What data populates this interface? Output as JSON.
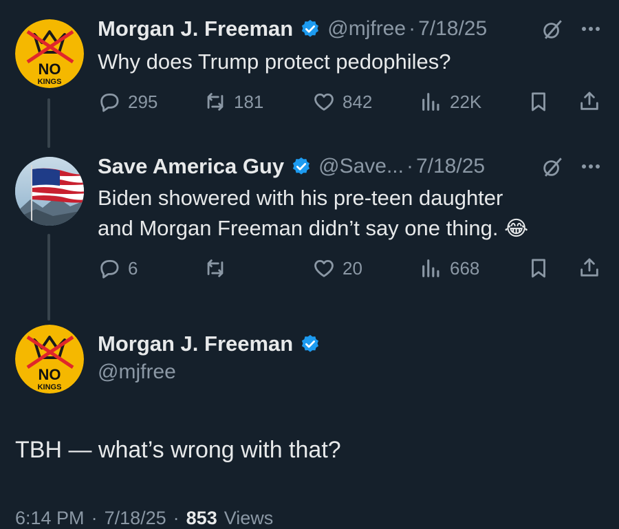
{
  "tweet1": {
    "name": "Morgan J. Freeman",
    "handle": "@mjfree",
    "sep": "·",
    "date": "7/18/25",
    "text": "Why does Trump protect pedophiles?",
    "avatar_text_top": "NO",
    "avatar_text_bottom": "KINGS",
    "replies": "295",
    "reposts": "181",
    "likes": "842",
    "views": "22K"
  },
  "tweet2": {
    "name": "Save America Guy",
    "handle": "@Save...",
    "sep": "·",
    "date": "7/18/25",
    "text_line1": "Biden showered with his pre-teen daughter",
    "text_line2": "and Morgan Freeman didn’t say one thing.",
    "emoji": "😂",
    "replies": "6",
    "reposts": "",
    "likes": "20",
    "views": "668"
  },
  "main_tweet": {
    "name": "Morgan J. Freeman",
    "handle": "@mjfree",
    "avatar_text_top": "NO",
    "avatar_text_bottom": "KINGS",
    "text": "TBH — what’s wrong with that?",
    "footer_time": "6:14 PM",
    "footer_sep": "·",
    "footer_date": "7/18/25",
    "footer_sep2": "·",
    "footer_views_count": "853",
    "footer_views_label": "Views"
  },
  "colors": {
    "background": "#15202b",
    "text": "#e7e9ea",
    "muted": "#8b98a5",
    "verified": "#1d9bf0",
    "avatar_yellow": "#f5b800",
    "cross_red": "#e0262b"
  },
  "icons": [
    "verified-badge-icon",
    "grok-icon",
    "more-icon",
    "reply-icon",
    "repost-icon",
    "like-icon",
    "views-icon",
    "bookmark-icon",
    "share-icon"
  ]
}
